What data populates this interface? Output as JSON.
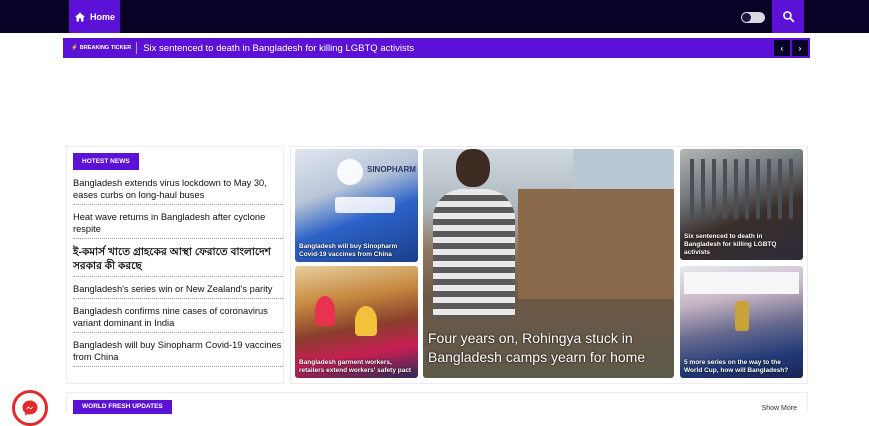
{
  "header": {
    "home_label": "Home",
    "home_icon": "home-icon",
    "theme_toggle_icon": "theme-toggle-icon",
    "search_icon": "search-icon",
    "accent_color": "#5b12d6",
    "background_color": "#070226"
  },
  "ticker": {
    "label": "BREAKING TICKER",
    "headline": "Six sentenced to death in Bangladesh for killing LGBTQ activists",
    "prev_icon": "chevron-left-icon",
    "next_icon": "chevron-right-icon"
  },
  "hot_news": {
    "title": "HOTEST NEWS",
    "items": [
      "Bangladesh extends virus lockdown to May 30, eases curbs on long-haul buses",
      "Heat wave returns in Bangladesh after cyclone respite",
      "ই-কমার্স খাতে গ্রাহকের আস্থা ফেরাতে বাংলাদেশ সরকার কী করছে",
      "Bangladesh's series win or New Zealand's parity",
      "Bangladesh confirms nine cases of coronavirus variant dominant in India",
      "Bangladesh will buy Sinopharm Covid-19 vaccines from China"
    ]
  },
  "featured": {
    "card1": "Bangladesh will buy Sinopharm Covid-19 vaccines from China",
    "card1_logo": "SINOPHARM",
    "card2": "Bangladesh garment workers, retailers extend workers' safety pact",
    "main": "Four years on, Rohingya stuck in Bangladesh camps yearn for home",
    "card4": "Six sentenced to death in Bangladesh for killing LGBTQ activists",
    "card5": "5 more series on the way to the World Cup, how will Bangladesh?"
  },
  "world": {
    "title": "WORLD FRESH UPDATES",
    "show_more": "Show More"
  },
  "chat_widget": {
    "icon": "messenger-icon"
  }
}
